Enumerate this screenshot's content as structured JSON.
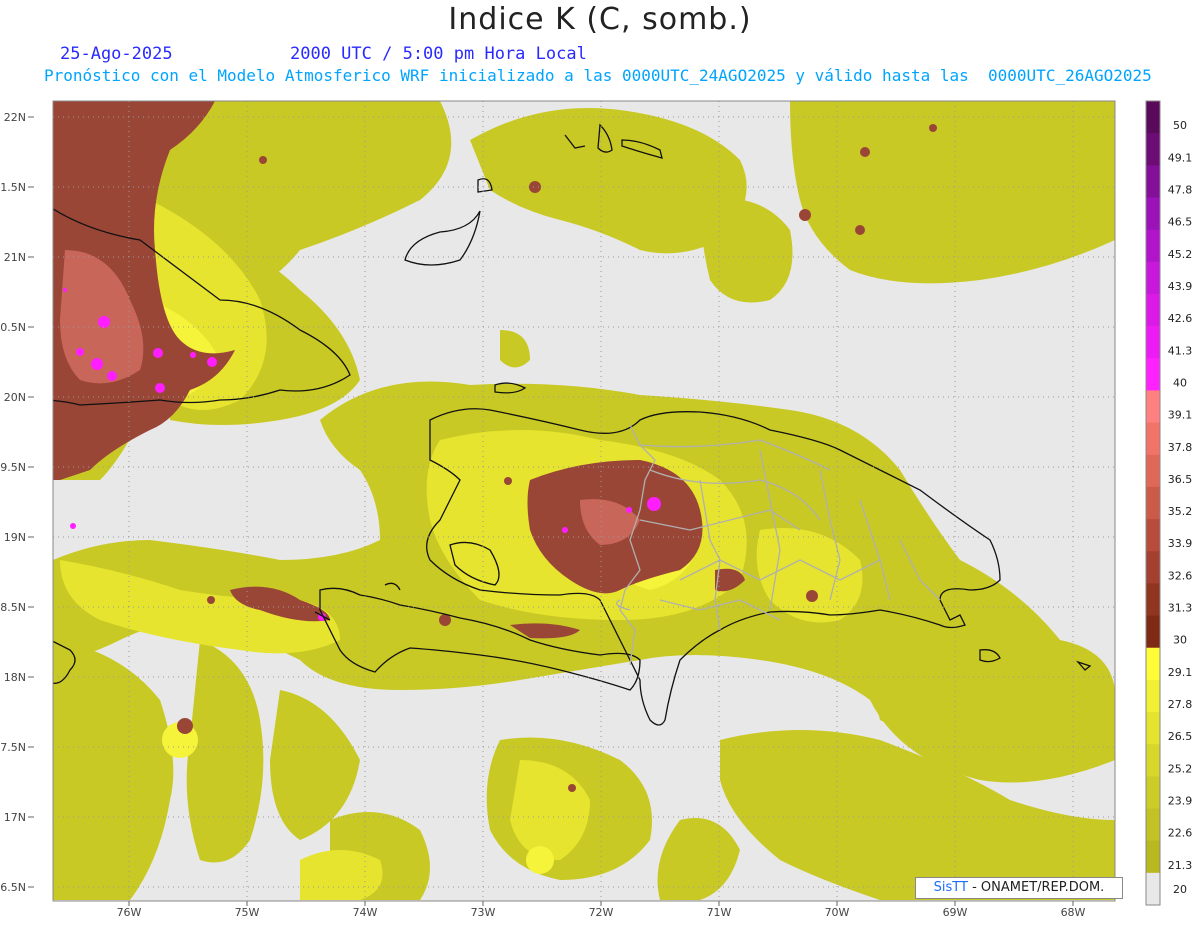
{
  "title": "Indice K (C, somb.)",
  "date_label": "25-Ago-2025",
  "time_label": "2000 UTC / 5:00 pm Hora Local",
  "subtitle": "Pronóstico con el Modelo Atmosferico WRF inicializado a las 0000UTC_24AGO2025 y válido hasta las  0000UTC_26AGO2025",
  "credit": {
    "logo": "SisTT",
    "text": " - ONAMET/REP.DOM."
  },
  "latitudes": [
    "22N",
    "1.5N",
    "21N",
    "0.5N",
    "20N",
    "9.5N",
    "19N",
    "8.5N",
    "18N",
    "7.5N",
    "17N",
    "6.5N"
  ],
  "longitudes": [
    "76W",
    "75W",
    "74W",
    "73W",
    "72W",
    "71W",
    "70W",
    "69W",
    "68W"
  ],
  "colorbar": {
    "labels": [
      "50",
      "49.1",
      "47.8",
      "46.5",
      "45.2",
      "43.9",
      "42.6",
      "41.3",
      "40",
      "39.1",
      "37.8",
      "36.5",
      "35.2",
      "33.9",
      "32.6",
      "31.3",
      "30",
      "29.1",
      "27.8",
      "26.5",
      "25.2",
      "23.9",
      "22.6",
      "21.3",
      "20"
    ],
    "colors": [
      "#5a0a5a",
      "#6e0c76",
      "#84109a",
      "#9a12b8",
      "#b214cc",
      "#c818dc",
      "#dc1ae8",
      "#ee1cf4",
      "#ff22ff",
      "#ff8080",
      "#f27468",
      "#e06858",
      "#cc5a48",
      "#b84c3c",
      "#a4402f",
      "#903520",
      "#7e2a14",
      "#fffc38",
      "#f1f032",
      "#e4e42e",
      "#d6d72a",
      "#cccc27",
      "#c2c224",
      "#b8b821",
      "#e8e8e8"
    ]
  },
  "colors": {
    "no_data": "#e8e8e8",
    "k20": "#c8c826",
    "k25": "#dada2c",
    "k28": "#f0ee34",
    "k30_35": "#9c4838",
    "k35_40": "#c86458",
    "k40": "#ff22ff"
  }
}
